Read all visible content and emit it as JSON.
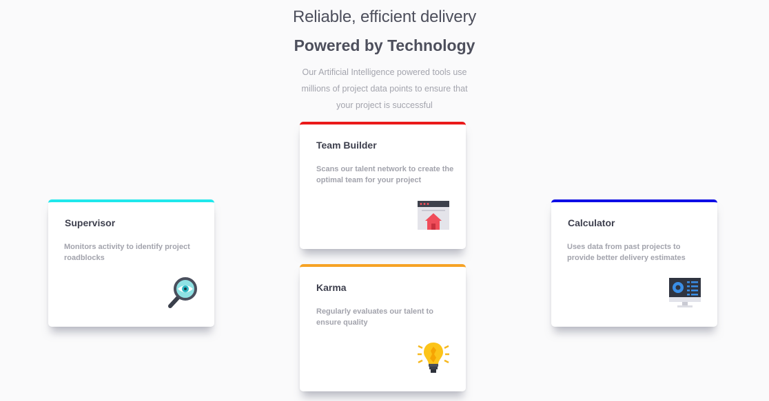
{
  "header": {
    "subtitle": "Reliable, efficient delivery",
    "title": "Powered by Technology",
    "description": "Our Artificial Intelligence powered tools use millions of project data points to ensure that your project is successful"
  },
  "cards": [
    {
      "title": "Supervisor",
      "text": "Monitors activity to identify project roadblocks",
      "accent": "#20e8ec",
      "icon": "magnifier-eye-icon"
    },
    {
      "title": "Team Builder",
      "text": "Scans our talent network to create the optimal team for your project",
      "accent": "#ea1a1a",
      "icon": "browser-team-icon"
    },
    {
      "title": "Karma",
      "text": "Regularly evaluates our talent to ensure quality",
      "accent": "#f6a224",
      "icon": "lightbulb-icon"
    },
    {
      "title": "Calculator",
      "text": "Uses data from past projects to provide better delivery estimates",
      "accent": "#0e0ee6",
      "icon": "monitor-dashboard-icon"
    }
  ]
}
